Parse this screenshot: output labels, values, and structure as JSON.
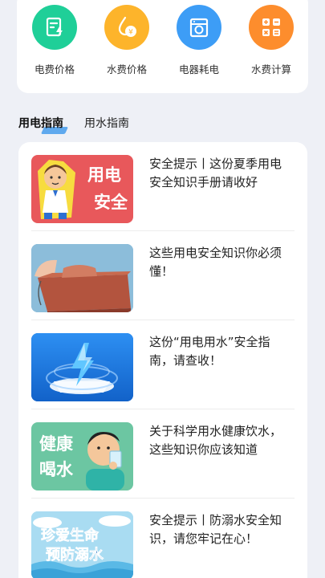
{
  "services": [
    {
      "label": "电费价格",
      "icon": "electricity-price-icon",
      "color": "#1fcf98"
    },
    {
      "label": "水费价格",
      "icon": "water-price-icon",
      "color": "#fdb42b"
    },
    {
      "label": "电器耗电",
      "icon": "appliance-power-icon",
      "color": "#3d9df6"
    },
    {
      "label": "水费计算",
      "icon": "calculator-icon",
      "color": "#fd8d2d"
    }
  ],
  "tabs": {
    "active": "用电指南",
    "inactive": "用水指南",
    "accent": "#5fa9ee"
  },
  "articles": [
    {
      "title": "安全提示丨这份夏季用电安全知识手册请收好",
      "thumb_text_1": "用电",
      "thumb_text_2": "安全"
    },
    {
      "title": "这些用电安全知识你必须懂！"
    },
    {
      "title": "这份“用电用水”安全指南，请查收！"
    },
    {
      "title": "关于科学用水健康饮水，这些知识你应该知道",
      "thumb_text_1": "健康",
      "thumb_text_2": "喝水"
    },
    {
      "title": "安全提示丨防溺水安全知识，请您牢记在心！",
      "thumb_text_1": "珍爱生命",
      "thumb_text_2": "预防溺水"
    }
  ]
}
